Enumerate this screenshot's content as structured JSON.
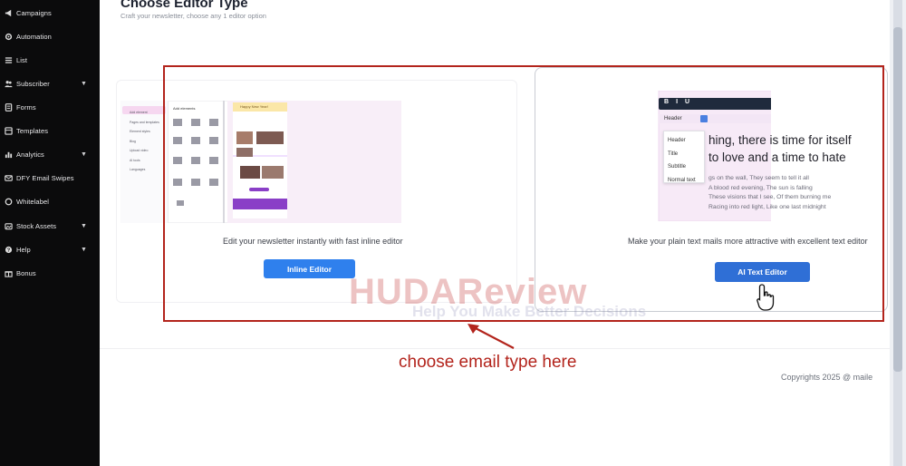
{
  "sidebar": {
    "items": [
      {
        "label": "Campaigns",
        "icon": "megaphone-icon",
        "caret": ""
      },
      {
        "label": "Automation",
        "icon": "gear-icon",
        "caret": ""
      },
      {
        "label": "List",
        "icon": "list-icon",
        "caret": ""
      },
      {
        "label": "Subscriber",
        "icon": "users-icon",
        "caret": "▼"
      },
      {
        "label": "Forms",
        "icon": "form-icon",
        "caret": ""
      },
      {
        "label": "Templates",
        "icon": "template-icon",
        "caret": ""
      },
      {
        "label": "Analytics",
        "icon": "chart-icon",
        "caret": "▼"
      },
      {
        "label": "DFY Email Swipes",
        "icon": "email-icon",
        "caret": ""
      },
      {
        "label": "Whitelabel",
        "icon": "circle-icon",
        "caret": ""
      },
      {
        "label": "Stock Assets",
        "icon": "stock-icon",
        "caret": "▼"
      },
      {
        "label": "Help",
        "icon": "help-icon",
        "caret": "▼"
      },
      {
        "label": "Bonus",
        "icon": "gift-icon",
        "caret": ""
      }
    ]
  },
  "header": {
    "title": "Choose Editor Type",
    "subtitle": "Craft your newsletter, choose any 1 editor option"
  },
  "cards": {
    "inline": {
      "description": "Edit your newsletter instantly with fast inline editor",
      "button": "Inline Editor",
      "preview": {
        "left_menu": [
          "Add element",
          "Pages and templates",
          "Element styles",
          "Blog",
          "Upload video",
          "AI tools",
          "Languages"
        ],
        "panel_title": "Add elements",
        "email_heading": "Happy New Year!"
      }
    },
    "ai": {
      "description": "Make your plain text mails more attractive with excellent text editor",
      "button": "AI Text Editor",
      "preview": {
        "toolbar_top": [
          "B",
          "I",
          "U"
        ],
        "format_select": "Header",
        "dropdown": [
          "Header",
          "Title",
          "Subtitle",
          "Normal text"
        ],
        "headline_line1": "hing, there is time for itself",
        "headline_line2": "to love and a time to hate",
        "body_lines": [
          "gs on the wall, They seem to tell it all",
          "A blood red evening, The sun is falling",
          "These visions that I see, Of them burning me",
          "Racing into red light, Like one last midnight"
        ]
      }
    }
  },
  "overlay": {
    "watermark": "HUDAReview",
    "watermark_tagline": "Help You Make Better Decisions",
    "annotation": "choose email type here"
  },
  "footer": {
    "copyright": "Copyrights 2025 @   maile"
  },
  "colors": {
    "sidebar_bg": "#0b0b0c",
    "button_blue": "#2f80ed",
    "highlight_red": "#b3241c"
  }
}
